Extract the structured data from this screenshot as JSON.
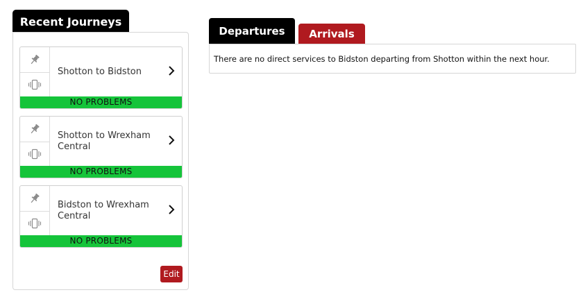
{
  "recent": {
    "title": "Recent Journeys",
    "journeys": [
      {
        "label": "Shotton to Bidston",
        "status": "NO PROBLEMS"
      },
      {
        "label": "Shotton to Wrexham Central",
        "status": "NO PROBLEMS"
      },
      {
        "label": "Bidston to Wrexham Central",
        "status": "NO PROBLEMS"
      }
    ],
    "edit_label": "Edit",
    "status_color": "#15c43a",
    "accent_color": "#b01a1f"
  },
  "board": {
    "tabs": [
      {
        "label": "Departures",
        "active": true
      },
      {
        "label": "Arrivals",
        "active": false
      }
    ],
    "message": "There are no direct services to Bidston departing from Shotton within the next hour."
  },
  "icons": {
    "pin": "pin-icon",
    "vibrate": "vibrate-icon",
    "chevron": "chevron-right-icon"
  }
}
